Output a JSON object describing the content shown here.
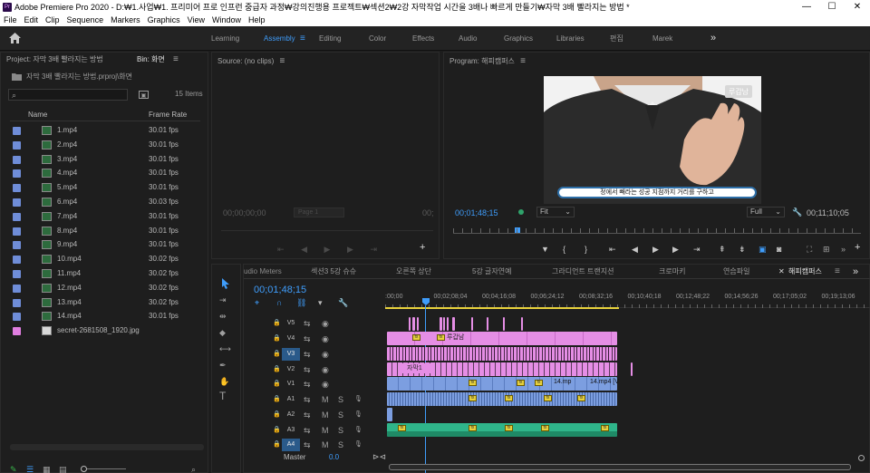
{
  "window": {
    "title": "Adobe Premiere Pro 2020 - D:₩1.사업₩1. 프리미어 프로 인프런 중급자 과정₩강의진행용 프로젝트₩섹션2₩2강 자막작업 시간을 3배나 빠르게 만들기₩자막 3배 빨라지는 방법 *",
    "app_icon": "Pr",
    "minimize": "—",
    "maximize": "☐",
    "close": "✕"
  },
  "menu": [
    "File",
    "Edit",
    "Clip",
    "Sequence",
    "Markers",
    "Graphics",
    "View",
    "Window",
    "Help"
  ],
  "workspaces": {
    "items": [
      "Learning",
      "Assembly",
      "Editing",
      "Color",
      "Effects",
      "Audio",
      "Graphics",
      "Libraries",
      "편집",
      "Marek"
    ],
    "active": "Assembly",
    "more": "»"
  },
  "project_panel": {
    "tab_project": "Project: 자막 3배 빨라지는 방법",
    "tab_bin": "Bin: 화면",
    "path": "자막 3배 빨라지는 방법.prproj\\화면",
    "items_count": "15 Items",
    "columns": {
      "name": "Name",
      "frame_rate": "Frame Rate"
    },
    "rows": [
      {
        "name": "1.mp4",
        "rate": "30.01 fps",
        "color": "#6f8dd8"
      },
      {
        "name": "2.mp4",
        "rate": "30.01 fps",
        "color": "#6f8dd8"
      },
      {
        "name": "3.mp4",
        "rate": "30.01 fps",
        "color": "#6f8dd8"
      },
      {
        "name": "4.mp4",
        "rate": "30.01 fps",
        "color": "#6f8dd8"
      },
      {
        "name": "5.mp4",
        "rate": "30.01 fps",
        "color": "#6f8dd8"
      },
      {
        "name": "6.mp4",
        "rate": "30.03 fps",
        "color": "#6f8dd8"
      },
      {
        "name": "7.mp4",
        "rate": "30.01 fps",
        "color": "#6f8dd8"
      },
      {
        "name": "8.mp4",
        "rate": "30.01 fps",
        "color": "#6f8dd8"
      },
      {
        "name": "9.mp4",
        "rate": "30.01 fps",
        "color": "#6f8dd8"
      },
      {
        "name": "10.mp4",
        "rate": "30.02 fps",
        "color": "#6f8dd8"
      },
      {
        "name": "11.mp4",
        "rate": "30.02 fps",
        "color": "#6f8dd8"
      },
      {
        "name": "12.mp4",
        "rate": "30.02 fps",
        "color": "#6f8dd8"
      },
      {
        "name": "13.mp4",
        "rate": "30.02 fps",
        "color": "#6f8dd8"
      },
      {
        "name": "14.mp4",
        "rate": "30.01 fps",
        "color": "#6f8dd8"
      },
      {
        "name": "secret-2681508_1920.jpg",
        "rate": "",
        "color": "#e07ee0"
      }
    ]
  },
  "source_monitor": {
    "title": "Source: (no clips)",
    "timecode": "00;00;00;00",
    "page": "Page 1",
    "end_timecode": "00;"
  },
  "program_monitor": {
    "title": "Program: 해피캠퍼스",
    "timecode": "00;01;48;15",
    "fit": "Fit",
    "quality": "Full",
    "duration": "00;11;10;05",
    "subtitle": "정에서 빼라는 성공 지점까지 거리를 구하고",
    "watermark": "루갑남"
  },
  "timeline": {
    "tabs": [
      "udio Meters",
      "섹션3 5강 슈슈",
      "오른쪽 상단",
      "5강 글자연예",
      "그라디언트 트랜지션",
      "크로마키",
      "연습파일",
      "해피캠퍼스"
    ],
    "active_tab": "해피캠퍼스",
    "timecode": "00;01;48;15",
    "ruler": [
      ":00;00",
      "00;02;08;04",
      "00;04;16;08",
      "00;06;24;12",
      "00;08;32;16",
      "00;10;40;18",
      "00;12;48;22",
      "00;14;56;26",
      "00;17;05;02",
      "00;19;13;06",
      "00;21;2"
    ],
    "video_tracks": [
      "V5",
      "V4",
      "V3",
      "V2",
      "V1"
    ],
    "audio_tracks": [
      "A1",
      "A2",
      "A3",
      "A4"
    ],
    "master_label": "Master",
    "master_value": "0.0",
    "clip_labels": {
      "v4_text": "루갑남",
      "v2_text": "자막1",
      "v1_a": "14.mp",
      "v1_b": "14.mp4 [V"
    },
    "colors": {
      "pink": "#e58ee5",
      "blue": "#7c9ee0",
      "green": "#2fb58a",
      "accent": "#3f9dfb"
    }
  }
}
